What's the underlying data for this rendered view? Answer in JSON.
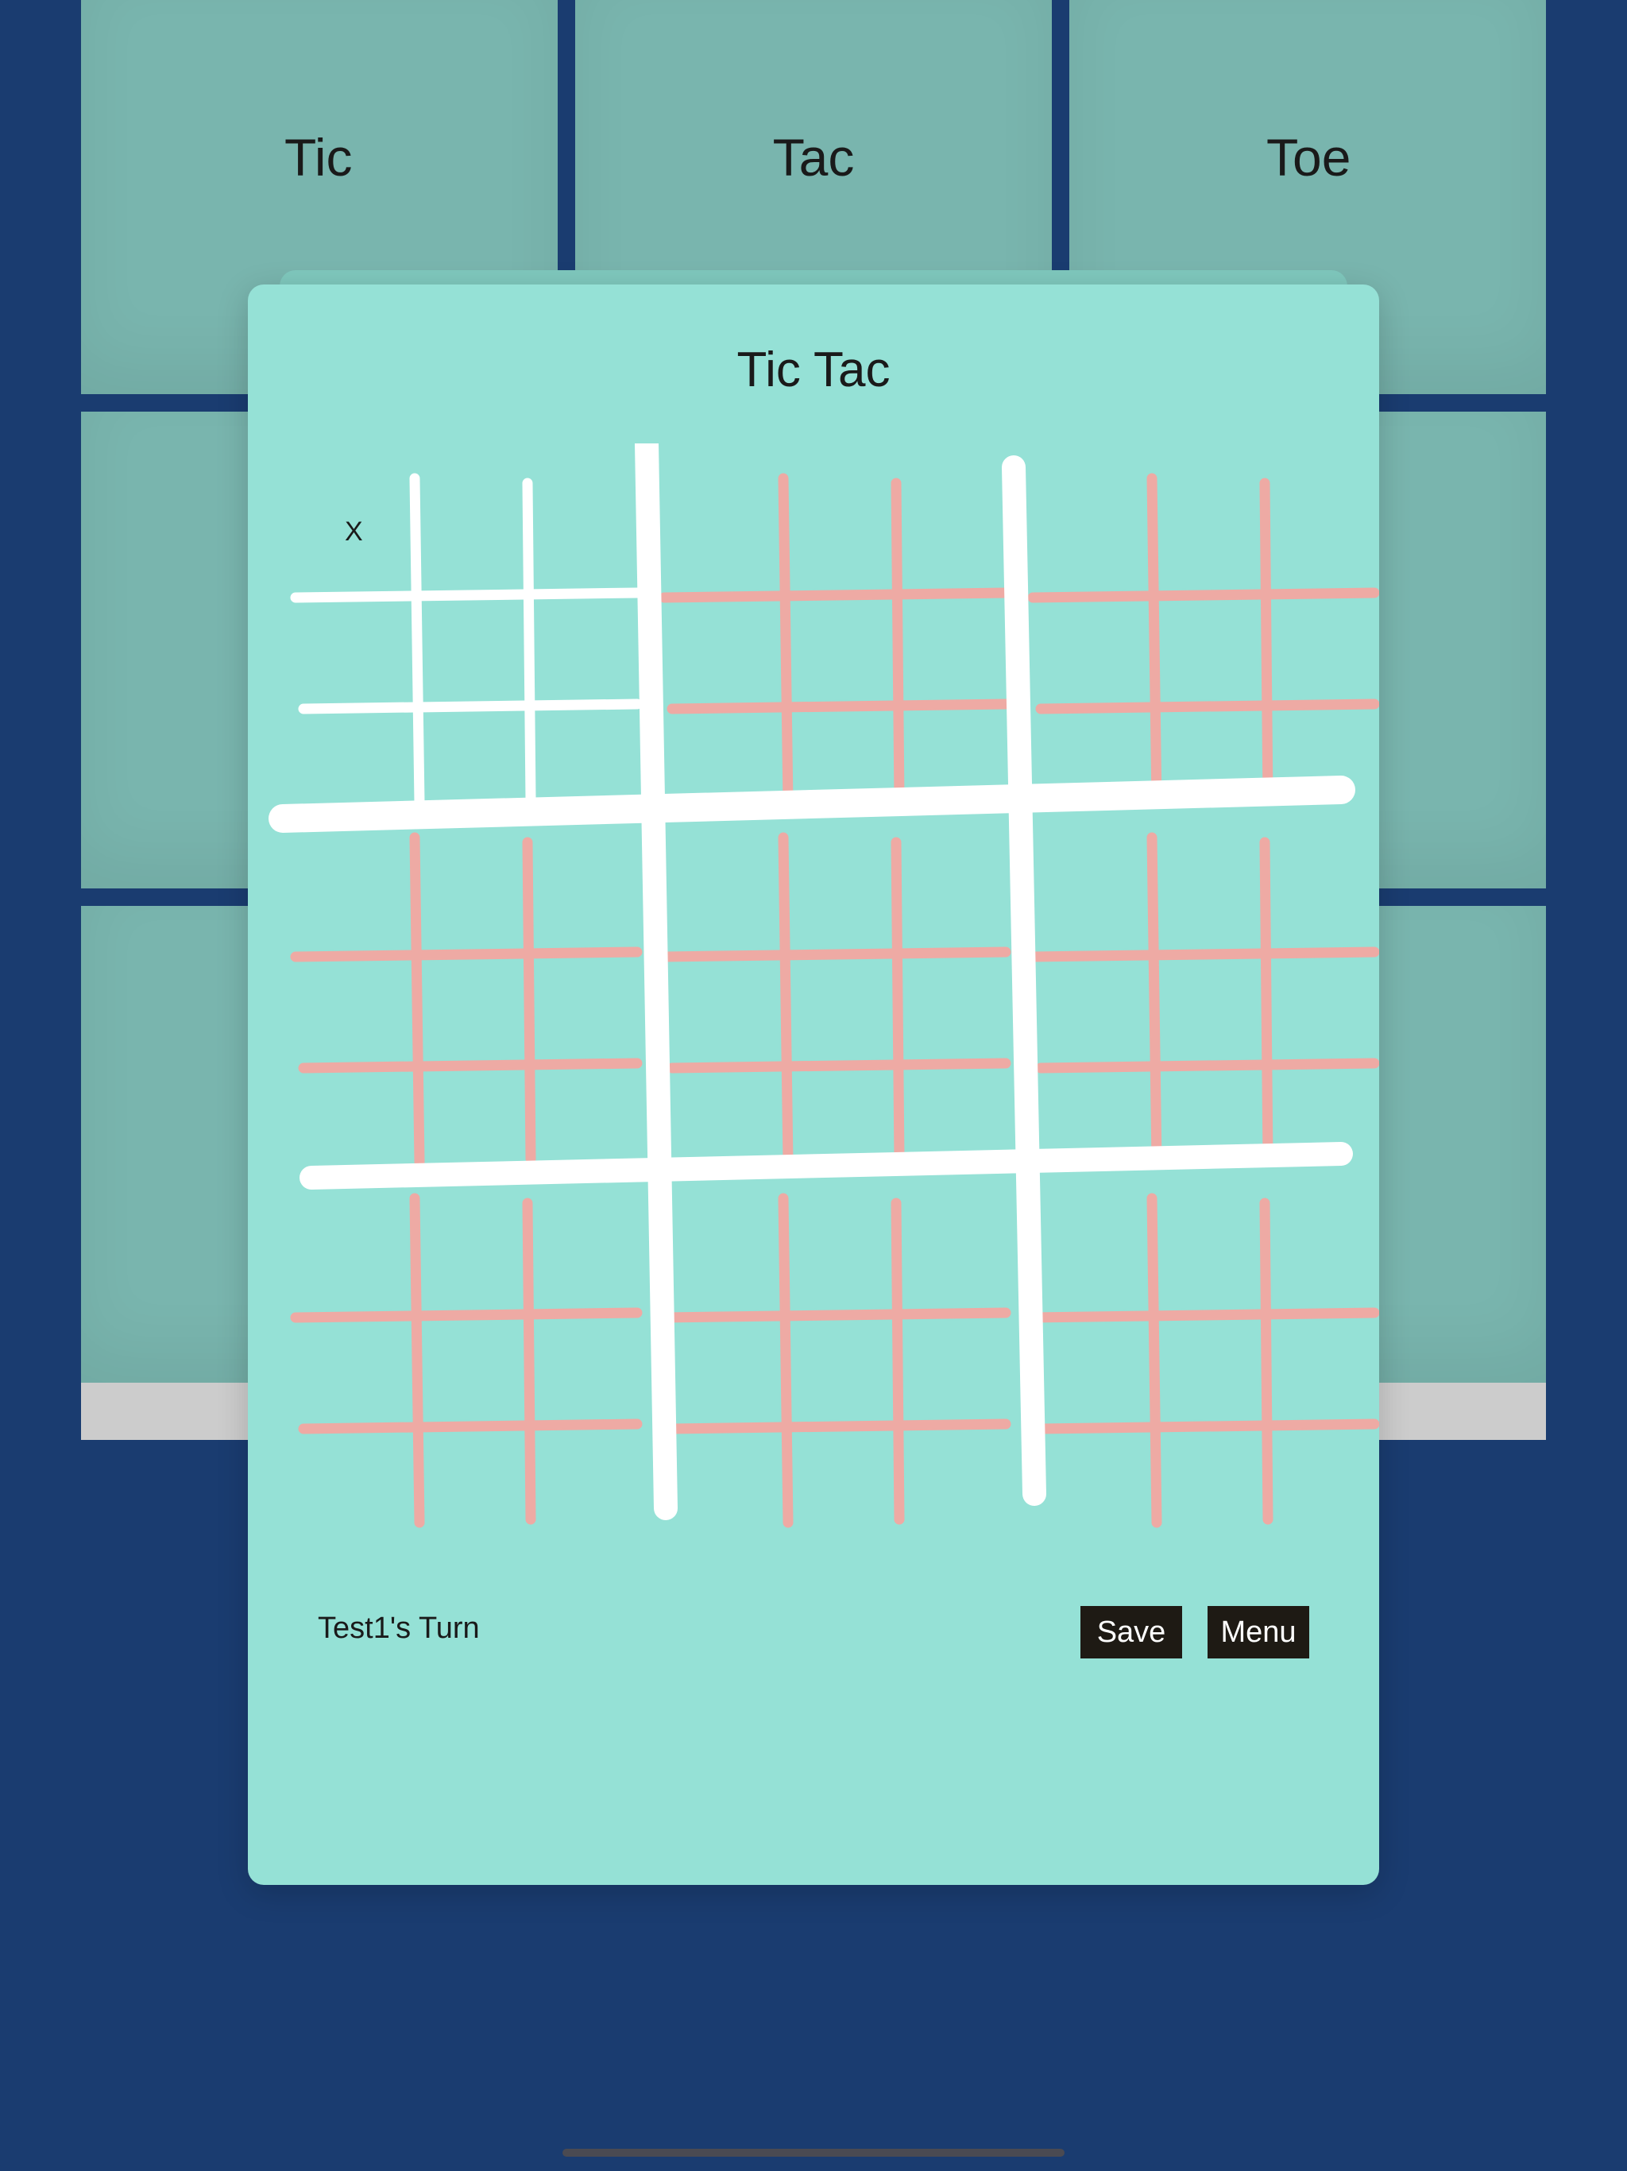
{
  "header_tiles": [
    {
      "label": "Tic"
    },
    {
      "label": "Tac"
    },
    {
      "label": "Toe"
    }
  ],
  "dialog": {
    "title": "Tic Tac",
    "board": {
      "sub_boards": 9,
      "active_sub_board": 0,
      "cells": [
        [
          "X",
          "",
          "",
          "",
          "",
          "",
          "",
          "",
          ""
        ],
        [
          "",
          "",
          "",
          "",
          "",
          "",
          "",
          "",
          ""
        ],
        [
          "",
          "",
          "",
          "",
          "",
          "",
          "",
          "",
          ""
        ],
        [
          "",
          "",
          "",
          "",
          "",
          "",
          "",
          "",
          ""
        ],
        [
          "",
          "",
          "",
          "",
          "",
          "",
          "",
          "",
          ""
        ],
        [
          "",
          "",
          "",
          "",
          "",
          "",
          "",
          "",
          ""
        ],
        [
          "",
          "",
          "",
          "",
          "",
          "",
          "",
          "",
          ""
        ],
        [
          "",
          "",
          "",
          "",
          "",
          "",
          "",
          "",
          ""
        ],
        [
          "",
          "",
          "",
          "",
          "",
          "",
          "",
          "",
          ""
        ]
      ],
      "marks": [
        {
          "sub_board": 0,
          "cell": 0,
          "symbol": "X"
        }
      ]
    },
    "status": "Test1's Turn",
    "save_label": "Save",
    "menu_label": "Menu"
  },
  "colors": {
    "background": "#1a3c70",
    "tile": "#79b5ae",
    "dialog": "#95e1d6",
    "main_grid": "#ffffff",
    "active_sub_grid": "#ffffff",
    "inactive_sub_grid": "#eeaaa4",
    "button": "#1e1a14"
  }
}
